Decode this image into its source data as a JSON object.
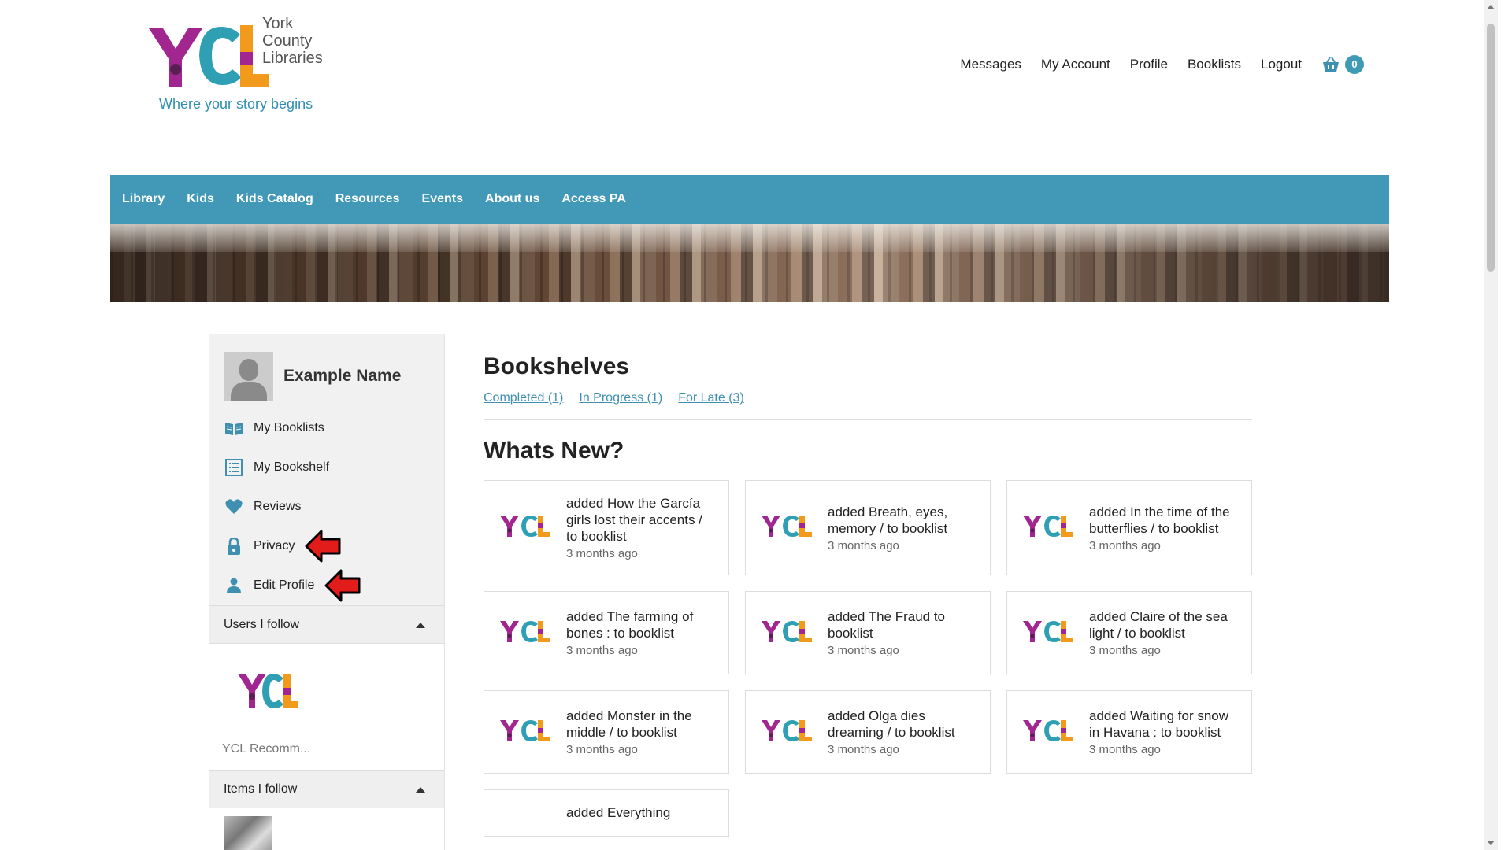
{
  "header": {
    "logo_lines": [
      "York",
      "County",
      "Libraries"
    ],
    "tagline": "Where your story begins",
    "top_links": [
      "Messages",
      "My Account",
      "Profile",
      "Booklists",
      "Logout"
    ],
    "cart_count": "0"
  },
  "main_nav": [
    "Library",
    "Kids",
    "Kids Catalog",
    "Resources",
    "Events",
    "About us",
    "Access PA"
  ],
  "sidebar": {
    "user_name": "Example Name",
    "items": [
      {
        "label": "My Booklists",
        "icon": "book-open-icon"
      },
      {
        "label": "My Bookshelf",
        "icon": "list-icon"
      },
      {
        "label": "Reviews",
        "icon": "heart-icon"
      },
      {
        "label": "Privacy",
        "icon": "lock-icon"
      },
      {
        "label": "Edit Profile",
        "icon": "user-icon"
      }
    ],
    "users_follow_label": "Users I follow",
    "followed_user": "YCL Recomm...",
    "items_follow_label": "Items I follow"
  },
  "content": {
    "bookshelves_title": "Bookshelves",
    "shelves": [
      "Completed (1)",
      "In Progress (1)",
      "For Late (3)"
    ],
    "whats_new_title": "Whats New?",
    "activity": [
      {
        "text": "added How the García girls lost their accents / to booklist",
        "time": "3 months ago"
      },
      {
        "text": "added Breath, eyes, memory / to booklist",
        "time": "3 months ago"
      },
      {
        "text": "added In the time of the butterflies / to booklist",
        "time": "3 months ago"
      },
      {
        "text": "added The farming of bones : to booklist",
        "time": "3 months ago"
      },
      {
        "text": "added The Fraud to booklist",
        "time": "3 months ago"
      },
      {
        "text": "added Claire of the sea light / to booklist",
        "time": "3 months ago"
      },
      {
        "text": "added Monster in the middle / to booklist",
        "time": "3 months ago"
      },
      {
        "text": "added Olga dies dreaming / to booklist",
        "time": "3 months ago"
      },
      {
        "text": "added Waiting for snow in Havana : to booklist",
        "time": "3 months ago"
      },
      {
        "text": "added Everything"
      }
    ]
  },
  "colors": {
    "nav_blue": "#4199b7",
    "link_blue": "#3e8fb0",
    "logo_purple": "#a1268f",
    "logo_teal": "#2fa0b4",
    "logo_orange": "#f19a1c",
    "arrow_red": "#e21b1b"
  }
}
